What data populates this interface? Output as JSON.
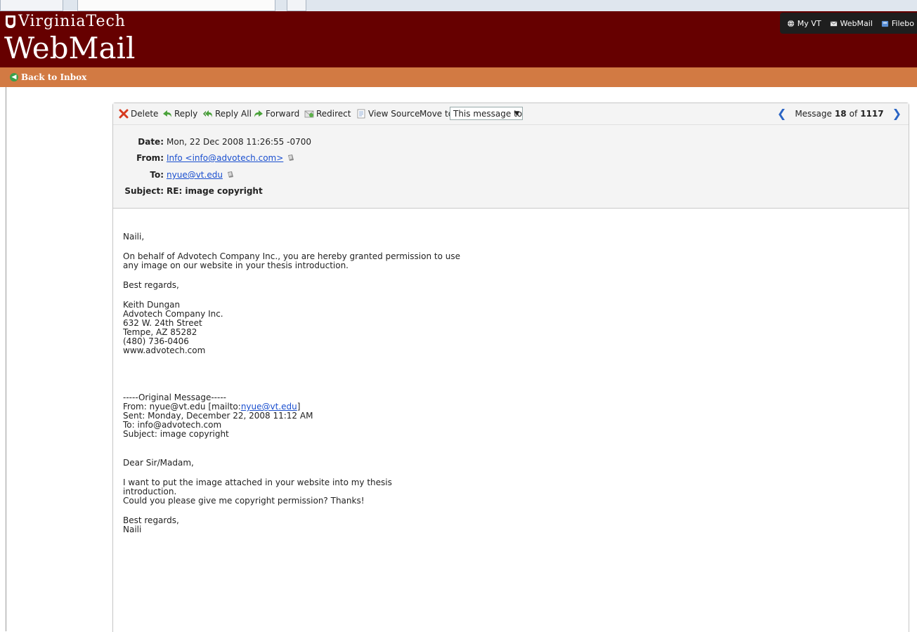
{
  "header": {
    "brand": "VirginiaTech",
    "app_name": "WebMail",
    "toplinks": [
      {
        "label": "My VT",
        "icon": "globe-icon"
      },
      {
        "label": "WebMail",
        "icon": "mail-icon"
      },
      {
        "label": "Filebo",
        "icon": "folder-icon"
      }
    ],
    "back_label": "Back to Inbox"
  },
  "toolbar": {
    "delete_label": "Delete",
    "reply_label": "Reply",
    "reply_all_label": "Reply All",
    "forward_label": "Forward",
    "redirect_label": "Redirect",
    "view_source_label": "View Source",
    "move_to_label": "Move to:",
    "move_to_value": "This message to"
  },
  "nav": {
    "message_label": "Message",
    "current": "18",
    "of_label": "of",
    "total": "1117"
  },
  "headers": {
    "date_label": "Date:",
    "date": "Mon, 22 Dec 2008 11:26:55 -0700",
    "from_label": "From:",
    "from": "Info <info@advotech.com>",
    "to_label": "To:",
    "to": "nyue@vt.edu",
    "subject_label": "Subject:",
    "subject": "RE: image copyright"
  },
  "body": {
    "greeting": "Naili,",
    "para1_line1": "On behalf of Advotech Company Inc., you are hereby granted permission to use",
    "para1_line2": "any image on our website in your thesis introduction.",
    "closing": "Best regards,",
    "sig_name": "Keith Dungan",
    "sig_company": "Advotech Company Inc.",
    "sig_street": "632 W. 24th Street",
    "sig_city": "Tempe, AZ 85282",
    "sig_phone": "(480) 736-0406",
    "sig_web": "www.advotech.com",
    "orig_header": "-----Original Message-----",
    "orig_from_prefix": "From: nyue@vt.edu [mailto:",
    "orig_from_link": "nyue@vt.edu",
    "orig_from_suffix": "]",
    "orig_sent": "Sent: Monday, December 22, 2008 11:12 AM",
    "orig_to": "To: info@advotech.com",
    "orig_subject": "Subject: image copyright",
    "orig_greeting": "Dear Sir/Madam,",
    "orig_line1": "I want to put the image attached in your website into my thesis",
    "orig_line2": "introduction.",
    "orig_line3": "Could you please give me copyright permission? Thanks!",
    "orig_closing": "Best regards,",
    "orig_name": "Naili"
  },
  "colors": {
    "header_bg": "#660000",
    "orange_bar": "#d27a43",
    "link": "#1a4fcf",
    "toolbar_bg": "#f4f4f4"
  }
}
